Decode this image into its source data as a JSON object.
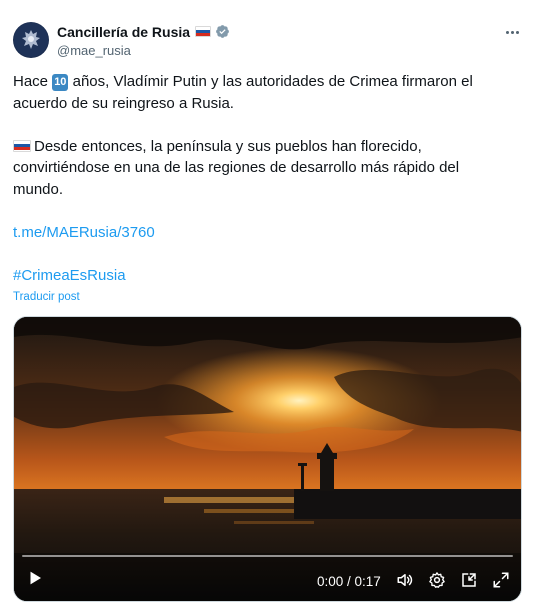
{
  "author": {
    "display_name": "Cancillería de Rusia",
    "handle": "@mae_rusia",
    "flag_colors": [
      "#ffffff",
      "#1c57a5",
      "#d52b1e"
    ],
    "verified_color": "#829aab"
  },
  "post": {
    "line1_pre": "Hace ",
    "badge": "10",
    "line1_post": " años, Vladímir Putin y las autoridades de Crimea firmaron el acuerdo de su reingreso a Rusia.",
    "para2": "Desde entonces, la península y sus pueblos han florecido, convirtiéndose en una de las regiones de desarrollo más rápido del mundo.",
    "link": "t.me/MAERusia/3760",
    "hashtag": "#CrimeaEsRusia",
    "translate": "Traducir post"
  },
  "video": {
    "time": "0:00 / 0:17",
    "progress": 0,
    "icons": [
      "play-icon",
      "volume-icon",
      "settings-icon",
      "pip-icon",
      "fullscreen-icon"
    ]
  },
  "colors": {
    "link": "#1d9bf0",
    "text": "#0f1419",
    "secondary": "#536471"
  }
}
